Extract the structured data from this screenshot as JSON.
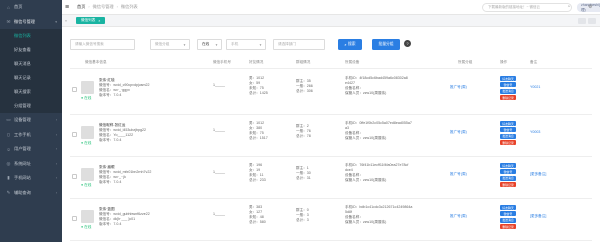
{
  "sidebar": {
    "items": [
      {
        "icon": "home-icon",
        "label": "首页",
        "kind": "item"
      },
      {
        "icon": "wechat-icon",
        "label": "微信号管理",
        "kind": "open"
      },
      {
        "icon": "",
        "label": "微信列表",
        "kind": "sub-active"
      },
      {
        "icon": "",
        "label": "好友查看",
        "kind": "sub"
      },
      {
        "icon": "",
        "label": "聊天消息",
        "kind": "sub"
      },
      {
        "icon": "",
        "label": "聊天记录",
        "kind": "sub"
      },
      {
        "icon": "",
        "label": "聊天搜索",
        "kind": "sub"
      },
      {
        "icon": "",
        "label": "分组管理",
        "kind": "sub"
      },
      {
        "icon": "monitor-icon",
        "label": "设备管理",
        "kind": "item"
      },
      {
        "icon": "phone-icon",
        "label": "工作手机",
        "kind": "item"
      },
      {
        "icon": "user-icon",
        "label": "用户管理",
        "kind": "item"
      },
      {
        "icon": "globe-icon",
        "label": "系统网址",
        "kind": "item"
      },
      {
        "icon": "mobile-icon",
        "label": "手机网站",
        "kind": "item"
      },
      {
        "icon": "wrench-icon",
        "label": "辅助查询",
        "kind": "item"
      }
    ]
  },
  "topbar": {
    "breadcrumb": [
      "首页",
      "微信号管理",
      "微信列表"
    ],
    "search_placeholder": "下载最新版的链接地址！~ 微信云",
    "user": "zhangheshi(管理)"
  },
  "tabs": {
    "active": "微信列表"
  },
  "filters": {
    "input1_placeholder": "请输入微信号搜索",
    "select1_placeholder": "微信分组",
    "status_value": "在线",
    "select2_placeholder": "手机",
    "input2_placeholder": "请选择部门",
    "search_label": "搜索",
    "batch_label": "批量分组",
    "help": "?"
  },
  "table": {
    "headers": [
      "微信基本信息",
      "微信手机号",
      "好友情况",
      "群组情况",
      "所属设备",
      "所属分组",
      "操作",
      "备注"
    ],
    "rows": [
      {
        "nick": "张伟·红毯",
        "online": "● 在线",
        "account": "微信号：wxid_c90cpvdpjusm22",
        "alias": "微信名：wx·_·ggyx",
        "version": "版本号：7.0.4",
        "phone": "1_____",
        "friends": [
          "男：1012",
          "女：59",
          "未知：75",
          "总计：1425"
        ],
        "groups": [
          "群主：35",
          "一般：266",
          "总计：306"
        ],
        "device": [
          "手机ID：4f18cd5c6bad459a6c08302a8",
          "e4427",
          "设备名称：",
          "保管人员：zzw10(周展伟)"
        ],
        "group": "推广号(周)",
        "ops": [
          "好友聊天",
          "微信号",
          "发送消息",
          "删除记录"
        ],
        "remark": "Y0021"
      },
      {
        "nick": "微信昵称-张红运",
        "online": "● 在线",
        "account": "微信号：wxid_l453ubzjbpg22",
        "alias": "微信名：Yo____1122",
        "version": "版本号：7.0.4",
        "phone": "1_____",
        "friends": [
          "男：1012",
          "女：380",
          "未知：75",
          "总计：1517"
        ],
        "groups": [
          "群主：2",
          "一般：76",
          "总计：78"
        ],
        "device": [
          "手机ID：0ffe1f0b2c05c5a07ed8ead055a7",
          "a3",
          "设备名称：",
          "保管人员：zzw10(周展伟)"
        ],
        "group": "推广号(周)",
        "ops": [
          "好友聊天",
          "微信号",
          "发送消息",
          "删除记录"
        ],
        "remark": "Y0003"
      },
      {
        "nick": "张伟·眉眼",
        "online": "● 在线",
        "account": "微信号：wxid_mfx01bn2rnh7v22",
        "alias": "微信名：wx·_··jk",
        "version": "版本号：7.0.4",
        "phone": "1_____",
        "friends": [
          "男：196",
          "女：19",
          "未知：11",
          "总计：233"
        ],
        "groups": [
          "群主：1",
          "一般：30",
          "总计：31"
        ],
        "device": [
          "手机ID：76f41b11ecff11f4fa0ea27e78cf",
          "dce4",
          "设备名称：",
          "保管人员：zzw10(周展伟)"
        ],
        "group": "推广号(周)",
        "ops": [
          "好友聊天",
          "微信号",
          "发送消息",
          "删除记录"
        ],
        "remark": "[更多备注]"
      },
      {
        "nick": "张伟·蓝图",
        "online": "● 在线",
        "account": "微信号：wxid_gubhbwnf6zze22",
        "alias": "微信名：dk[h·___ ]c01",
        "version": "版本号：7.0.4",
        "phone": "1_____",
        "friends": [
          "男：383",
          "女：127",
          "未知：48",
          "总计：580"
        ],
        "groups": [
          "群主：0",
          "一般：3",
          "总计：3"
        ],
        "device": [
          "手机ID：bdb1c41cdc3c212671c4249864a",
          "5d8f",
          "设备名称：",
          "保管人员：zzw10(周展伟)"
        ],
        "group": "推广号(周)",
        "ops": [
          "好友聊天",
          "微信号",
          "发送消息",
          "删除记录"
        ],
        "remark": "[更多备注]"
      }
    ]
  },
  "colors": {
    "sidebar_bg": "#2f3d4f",
    "accent": "#19b4a2",
    "primary": "#2a7ee3",
    "danger": "#e8432a",
    "online": "#1dbf73"
  }
}
